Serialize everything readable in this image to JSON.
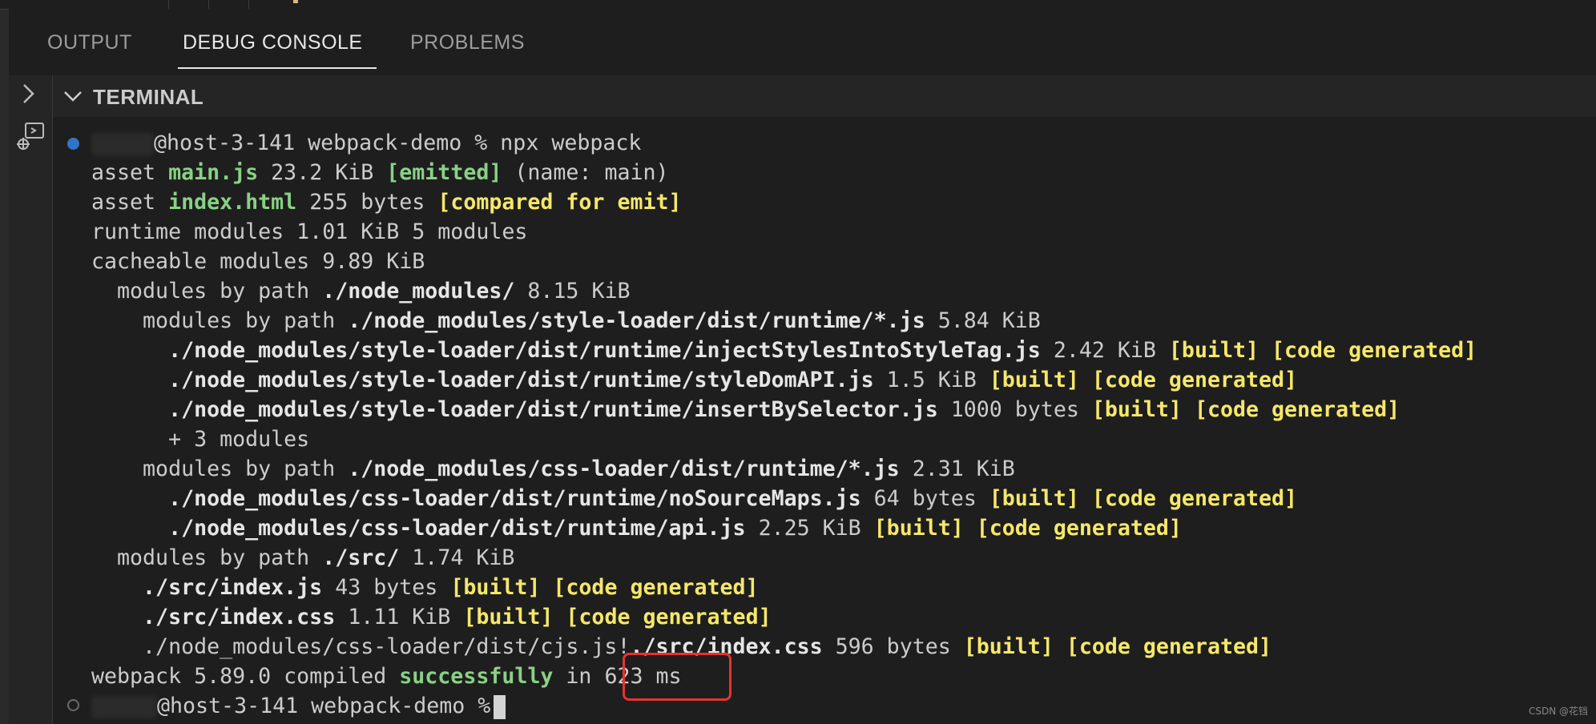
{
  "panel": {
    "tabs": [
      {
        "label": "OUTPUT"
      },
      {
        "label": "DEBUG CONSOLE"
      },
      {
        "label": "PROBLEMS"
      }
    ],
    "active_tab": "DEBUG CONSOLE"
  },
  "terminal": {
    "title": "TERMINAL",
    "prompt_command": "@host-3-141 webpack-demo % npx webpack",
    "final_prompt": "@host-3-141 webpack-demo %",
    "lines": {
      "l1": {
        "t1": "asset ",
        "name": "main.js",
        "t2": " 23.2 KiB ",
        "tag": "[emitted]",
        "t3": " (name: main)"
      },
      "l2": {
        "t1": "asset ",
        "name": "index.html",
        "t2": " 255 bytes ",
        "tag": "[compared for emit]"
      },
      "l3": "runtime modules 1.01 KiB 5 modules",
      "l4": "cacheable modules 9.89 KiB",
      "l5": {
        "t1": "  modules by path ",
        "path": "./node_modules/",
        "t2": " 8.15 KiB"
      },
      "l6": {
        "t1": "    modules by path ",
        "path": "./node_modules/style-loader/dist/runtime/*.js",
        "t2": " 5.84 KiB"
      },
      "l7": {
        "path": "      ./node_modules/style-loader/dist/runtime/injectStylesIntoStyleTag.js",
        "t2": " 2.42 KiB ",
        "tag": "[built] [code generated]"
      },
      "l8": {
        "path": "      ./node_modules/style-loader/dist/runtime/styleDomAPI.js",
        "t2": " 1.5 KiB ",
        "tag": "[built] [code generated]"
      },
      "l9": {
        "path": "      ./node_modules/style-loader/dist/runtime/insertBySelector.js",
        "t2": " 1000 bytes ",
        "tag": "[built] [code generated]"
      },
      "l10": "      + 3 modules",
      "l11": {
        "t1": "    modules by path ",
        "path": "./node_modules/css-loader/dist/runtime/*.js",
        "t2": " 2.31 KiB"
      },
      "l12": {
        "path": "      ./node_modules/css-loader/dist/runtime/noSourceMaps.js",
        "t2": " 64 bytes ",
        "tag": "[built] [code generated]"
      },
      "l13": {
        "path": "      ./node_modules/css-loader/dist/runtime/api.js",
        "t2": " 2.25 KiB ",
        "tag": "[built] [code generated]"
      },
      "l14": {
        "t1": "  modules by path ",
        "path": "./src/",
        "t2": " 1.74 KiB"
      },
      "l15": {
        "path": "    ./src/index.js",
        "t2": " 43 bytes ",
        "tag": "[built] [code generated]"
      },
      "l16": {
        "path": "    ./src/index.css",
        "t2": " 1.11 KiB ",
        "tag": "[built] [code generated]"
      },
      "l17": {
        "t1": "    ./node_modules/css-loader/dist/cjs.js!",
        "path": "./src/index.css",
        "t2": " 596 bytes ",
        "tag": "[built] [code generated]"
      },
      "l18": {
        "t1": "webpack 5.89.0 compiled ",
        "status": "successfully",
        "t2": " in ",
        "time": "623 ms"
      }
    }
  },
  "watermark": "CSDN @花铛",
  "colors": {
    "success": "#89d185",
    "tag": "#f5e76a",
    "highlight": "#e5342d"
  }
}
